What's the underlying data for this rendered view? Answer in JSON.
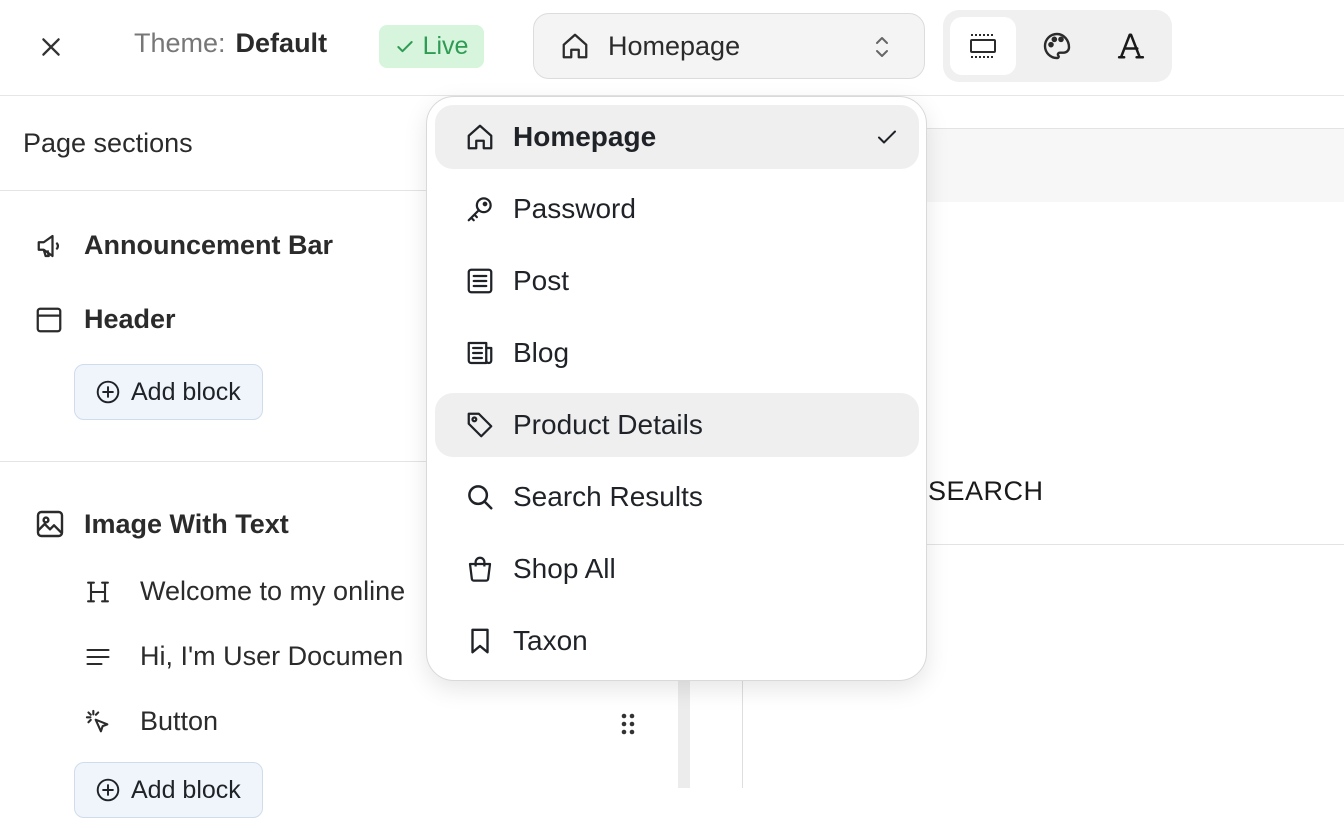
{
  "topbar": {
    "theme_label": "Theme:",
    "theme_name": "Default",
    "status_badge": "Live",
    "page_selector": "Homepage"
  },
  "sidebar": {
    "title": "Page sections",
    "sections": [
      {
        "label": "Announcement Bar",
        "icon": "megaphone-icon"
      },
      {
        "label": "Header",
        "icon": "window-icon",
        "add_block": "Add block"
      },
      {
        "label": "Image With Text",
        "icon": "image-icon"
      }
    ],
    "blocks": [
      {
        "label": "Welcome to my online",
        "icon": "heading-icon"
      },
      {
        "label": "Hi, I'm User Documen",
        "icon": "text-lines-icon"
      },
      {
        "label": "Button",
        "icon": "cursor-click-icon"
      }
    ],
    "add_block_bottom": "Add block"
  },
  "preview": {
    "search_text": "SEARCH"
  },
  "dropdown": {
    "items": [
      {
        "label": "Homepage",
        "icon": "home-icon",
        "selected": true
      },
      {
        "label": "Password",
        "icon": "key-icon"
      },
      {
        "label": "Post",
        "icon": "document-icon"
      },
      {
        "label": "Blog",
        "icon": "newspaper-icon"
      },
      {
        "label": "Product Details",
        "icon": "tag-icon",
        "hovered": true
      },
      {
        "label": "Search Results",
        "icon": "search-icon"
      },
      {
        "label": "Shop All",
        "icon": "shopping-bag-icon"
      },
      {
        "label": "Taxon",
        "icon": "bookmark-icon"
      }
    ]
  },
  "colors": {
    "live_bg": "#d6f5dc",
    "live_text": "#2f9b54",
    "add_block_bg": "#f0f5fb"
  }
}
